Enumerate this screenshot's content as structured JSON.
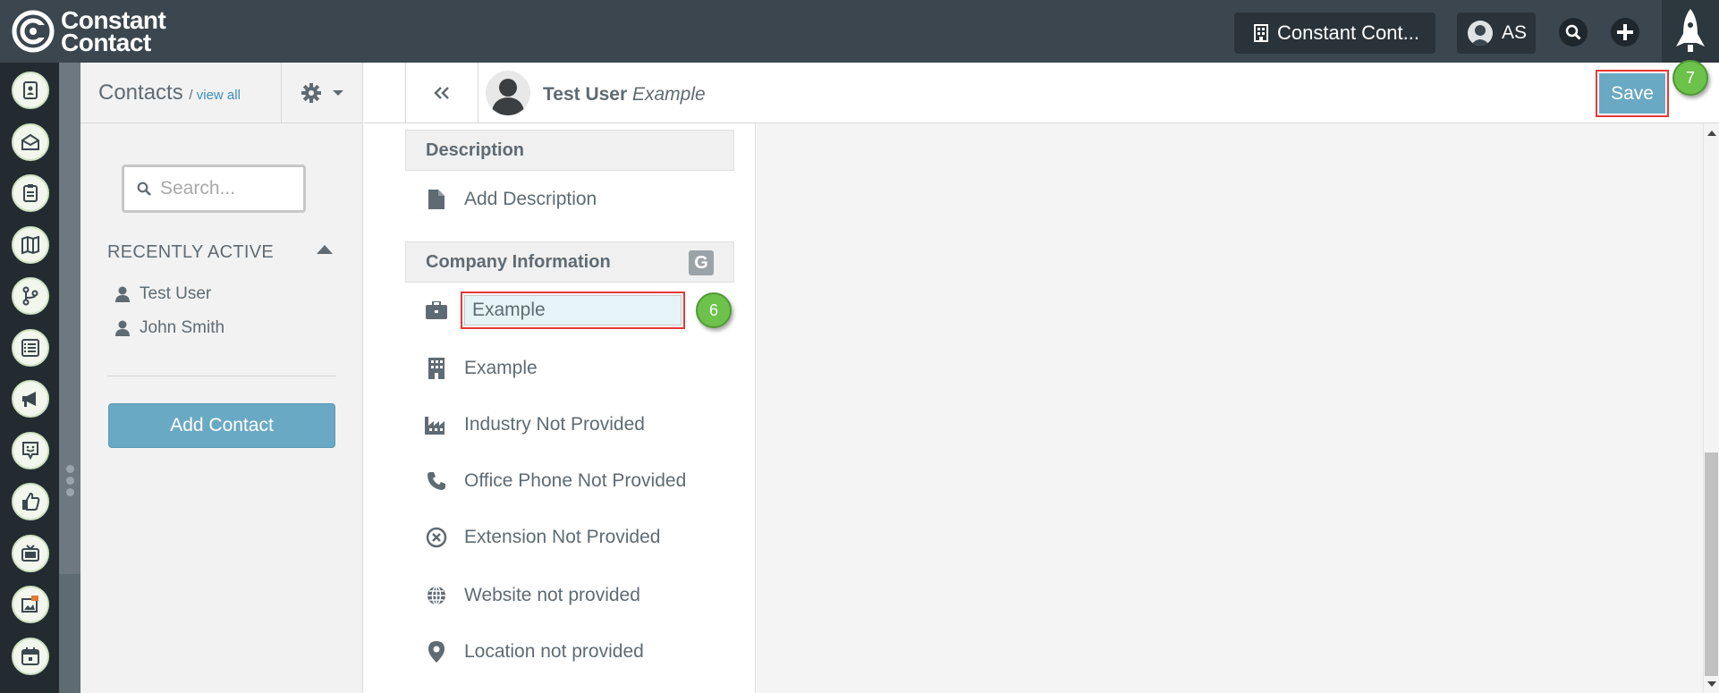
{
  "topbar": {
    "logo_line1": "Constant",
    "logo_line2": "Contact",
    "account_label": "Constant Cont...",
    "user_initials": "AS",
    "icons": [
      "building-icon",
      "user-avatar-icon",
      "search-icon",
      "plus-icon",
      "rocket-icon"
    ]
  },
  "left_rail": {
    "icons": [
      "contacts-icon",
      "email-icon",
      "clipboard-icon",
      "map-icon",
      "workflow-icon",
      "list-icon",
      "megaphone-icon",
      "survey-icon",
      "thumbs-up-icon",
      "tv-icon",
      "image-icon",
      "calendar-icon"
    ]
  },
  "contacts_panel": {
    "title": "Contacts",
    "view_all_sep": "/",
    "view_all": "view all",
    "search_placeholder": "Search...",
    "recently_active_label": "RECENTLY ACTIVE",
    "recent": [
      "Test User",
      "John Smith"
    ],
    "add_contact_label": "Add Contact"
  },
  "record_header": {
    "name": "Test User",
    "company": "Example",
    "save_label": "Save",
    "save_step": "7"
  },
  "description": {
    "heading": "Description",
    "add_label": "Add Description"
  },
  "company_info": {
    "heading": "Company Information",
    "g_badge": "G",
    "company_name_value": "Example",
    "company_step": "6",
    "division": "Example",
    "industry": "Industry Not Provided",
    "office_phone": "Office Phone Not Provided",
    "extension": "Extension Not Provided",
    "website": "Website not provided",
    "location": "Location not provided"
  },
  "colors": {
    "topbar": "#3b464e",
    "accent_button": "#6aa9c4",
    "highlight_red": "#e53935",
    "step_green": "#6cc24a"
  }
}
